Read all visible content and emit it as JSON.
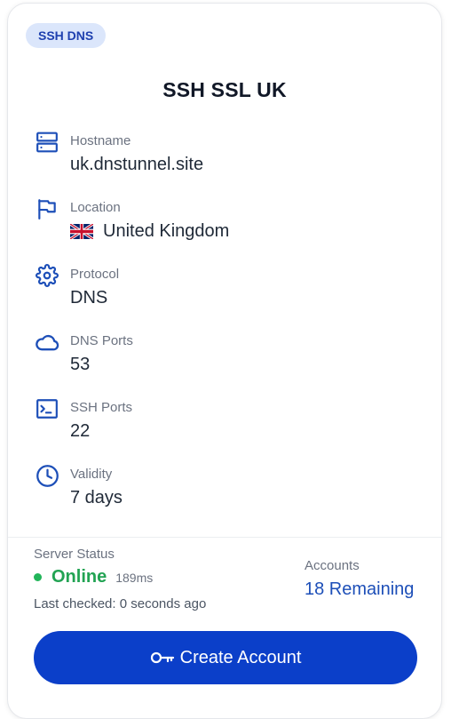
{
  "badge": "SSH DNS",
  "title": "SSH SSL UK",
  "accent_color": "#0b3fc9",
  "status_color": "#22a353",
  "details": [
    {
      "icon": "server-icon",
      "label": "Hostname",
      "value": "uk.dnstunnel.site"
    },
    {
      "icon": "flag-icon",
      "label": "Location",
      "value": "United Kingdom",
      "flag": "uk-flag"
    },
    {
      "icon": "gear-icon",
      "label": "Protocol",
      "value": "DNS"
    },
    {
      "icon": "cloud-icon",
      "label": "DNS Ports",
      "value": "53"
    },
    {
      "icon": "terminal-icon",
      "label": "SSH Ports",
      "value": "22"
    },
    {
      "icon": "clock-icon",
      "label": "Validity",
      "value": "7 days"
    }
  ],
  "server_status": {
    "label": "Server Status",
    "status": "Online",
    "latency": "189ms",
    "last_checked": "Last checked: 0 seconds ago"
  },
  "accounts": {
    "label": "Accounts",
    "value": "18 Remaining"
  },
  "create_button": {
    "icon": "key-icon",
    "label": "Create Account"
  }
}
